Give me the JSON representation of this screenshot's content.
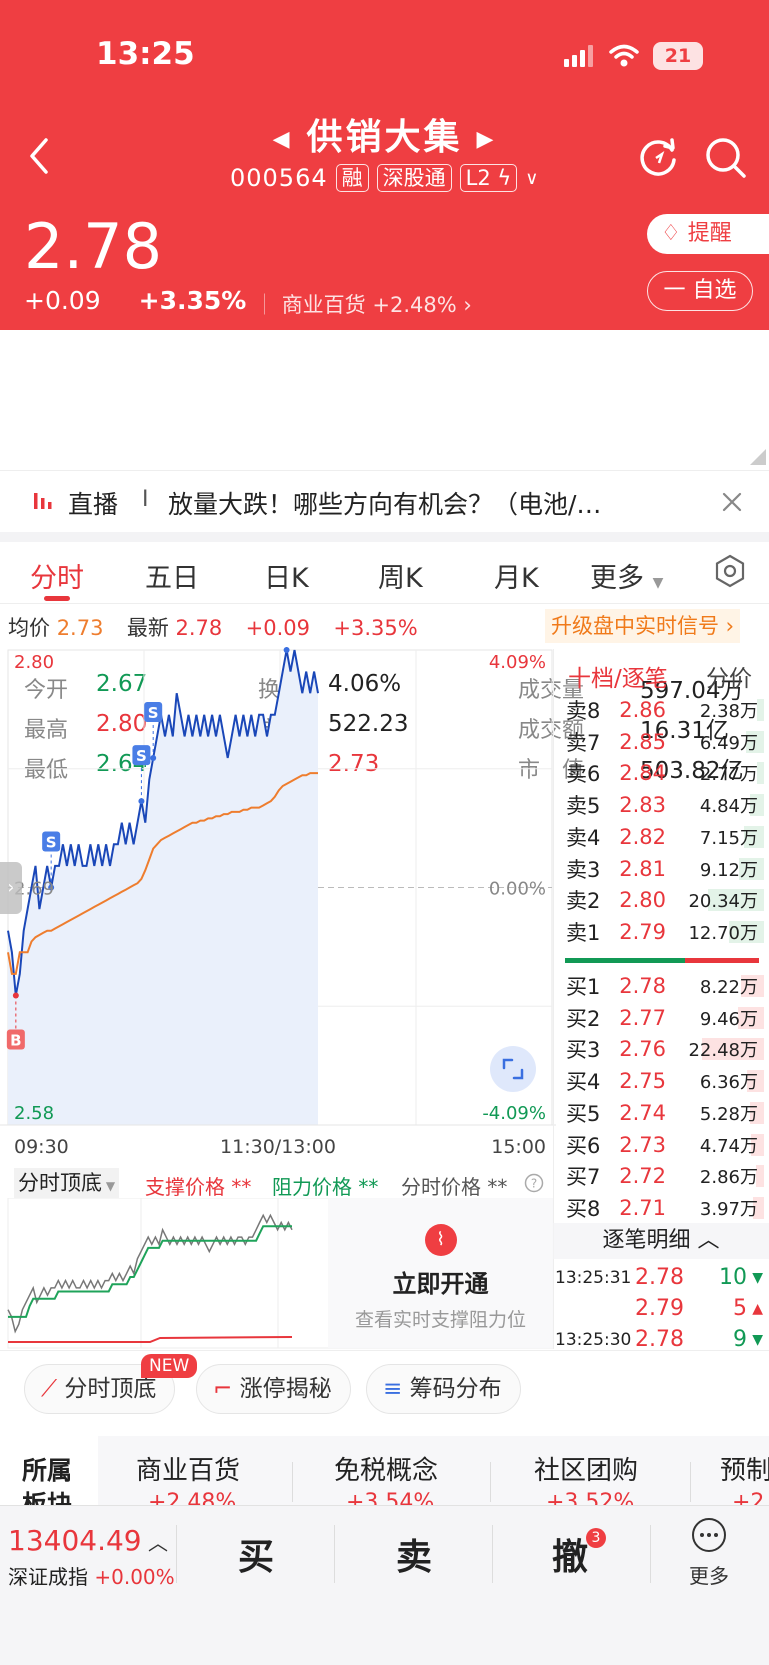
{
  "status": {
    "time": "13:25",
    "battery": "21"
  },
  "header": {
    "name": "供销大集",
    "code": "000564",
    "tag_margin": "融",
    "tag_connect": "深股通",
    "tag_level": "L2",
    "price": "2.78",
    "change": "+0.09",
    "change_pct": "+3.35%",
    "sector_name": "商业百货",
    "sector_pct": "+2.48%",
    "remind_label": "提醒",
    "watch_label": "一 自选"
  },
  "stats": [
    {
      "label": "今开",
      "value": "2.67",
      "tone": "green"
    },
    {
      "label": "换手",
      "value": "4.06%",
      "tone": "dark"
    },
    {
      "label": "成交量",
      "value": "597.04万",
      "tone": "dark"
    },
    {
      "label": "最高",
      "value": "2.80",
      "tone": "red"
    },
    {
      "label": "市盈",
      "value": "522.23",
      "tone": "dark"
    },
    {
      "label": "成交额",
      "value": "16.31亿",
      "tone": "dark"
    },
    {
      "label": "最低",
      "value": "2.64",
      "tone": "green"
    },
    {
      "label": "均价",
      "value": "2.73",
      "tone": "red"
    },
    {
      "label": "市　值",
      "value": "503.82亿",
      "tone": "dark"
    }
  ],
  "live": {
    "tag": "直播",
    "sep": "I",
    "text": "放量大跌！哪些方向有机会？（电池/…"
  },
  "tabs": [
    "分时",
    "五日",
    "日K",
    "周K",
    "月K",
    "更多"
  ],
  "info_bar": {
    "avg_label": "均价",
    "avg_value": "2.73",
    "last_label": "最新",
    "last_value": "2.78",
    "chg": "+0.09",
    "chg_pct": "+3.35%",
    "upgrade": "升级盘中实时信号"
  },
  "chart_data": {
    "type": "line",
    "title": "",
    "y_left_ticks": [
      "2.80",
      "2.69",
      "2.58"
    ],
    "y_right_ticks": [
      "4.09%",
      "0.00%",
      "-4.09%"
    ],
    "x_ticks": [
      "09:30",
      "11:30/13:00",
      "15:00"
    ],
    "ylim": [
      2.58,
      2.8
    ],
    "prev_close": 2.69,
    "series": [
      {
        "name": "price",
        "color": "#1a47b8",
        "values": [
          2.67,
          2.66,
          2.64,
          2.65,
          2.67,
          2.68,
          2.69,
          2.7,
          2.68,
          2.69,
          2.7,
          2.69,
          2.7,
          2.7,
          2.71,
          2.7,
          2.71,
          2.7,
          2.71,
          2.7,
          2.7,
          2.71,
          2.7,
          2.71,
          2.7,
          2.71,
          2.7,
          2.71,
          2.71,
          2.72,
          2.71,
          2.72,
          2.71,
          2.72,
          2.73,
          2.72,
          2.74,
          2.75,
          2.76,
          2.77,
          2.76,
          2.77,
          2.76,
          2.78,
          2.77,
          2.76,
          2.77,
          2.76,
          2.77,
          2.76,
          2.77,
          2.76,
          2.77,
          2.76,
          2.77,
          2.76,
          2.75,
          2.76,
          2.77,
          2.76,
          2.77,
          2.76,
          2.77,
          2.76,
          2.77,
          2.77,
          2.76,
          2.77,
          2.77,
          2.78,
          2.79,
          2.8,
          2.79,
          2.8,
          2.79,
          2.78,
          2.79,
          2.78,
          2.79,
          2.78
        ]
      },
      {
        "name": "avg",
        "color": "#ee7d2e",
        "values": [
          2.66,
          2.65,
          2.65,
          2.66,
          2.66,
          2.66,
          2.665,
          2.667,
          2.668,
          2.669,
          2.67,
          2.67,
          2.671,
          2.672,
          2.673,
          2.674,
          2.675,
          2.676,
          2.677,
          2.678,
          2.679,
          2.68,
          2.681,
          2.682,
          2.683,
          2.684,
          2.685,
          2.686,
          2.687,
          2.688,
          2.689,
          2.69,
          2.691,
          2.692,
          2.694,
          2.698,
          2.703,
          2.708,
          2.71,
          2.712,
          2.713,
          2.714,
          2.715,
          2.716,
          2.717,
          2.718,
          2.719,
          2.72,
          2.72,
          2.721,
          2.721,
          2.722,
          2.722,
          2.723,
          2.723,
          2.724,
          2.724,
          2.725,
          2.725,
          2.725,
          2.726,
          2.726,
          2.727,
          2.727,
          2.727,
          2.728,
          2.729,
          2.73,
          2.732,
          2.735,
          2.737,
          2.738,
          2.739,
          2.74,
          2.741,
          2.742,
          2.742,
          2.743,
          2.743,
          2.743
        ]
      }
    ],
    "markers": [
      {
        "label": "B",
        "type": "buy"
      },
      {
        "label": "S",
        "type": "sell"
      },
      {
        "label": "S",
        "type": "sell"
      },
      {
        "label": "S",
        "type": "sell"
      },
      {
        "label": "S",
        "type": "sell"
      }
    ]
  },
  "order_book": {
    "header_title": "十档/逐笔",
    "header_right": "分价",
    "asks": [
      {
        "label": "卖8",
        "price": "2.86",
        "vol": "2.38万",
        "ratio": 0.11
      },
      {
        "label": "卖7",
        "price": "2.85",
        "vol": "6.49万",
        "ratio": 0.29
      },
      {
        "label": "卖6",
        "price": "2.84",
        "vol": "2.77万",
        "ratio": 0.12
      },
      {
        "label": "卖5",
        "price": "2.83",
        "vol": "4.84万",
        "ratio": 0.22
      },
      {
        "label": "卖4",
        "price": "2.82",
        "vol": "7.15万",
        "ratio": 0.32
      },
      {
        "label": "卖3",
        "price": "2.81",
        "vol": "9.12万",
        "ratio": 0.41
      },
      {
        "label": "卖2",
        "price": "2.80",
        "vol": "20.34万",
        "ratio": 0.9
      },
      {
        "label": "卖1",
        "price": "2.79",
        "vol": "12.70万",
        "ratio": 0.56
      }
    ],
    "bids": [
      {
        "label": "买1",
        "price": "2.78",
        "vol": "8.22万",
        "ratio": 0.37
      },
      {
        "label": "买2",
        "price": "2.77",
        "vol": "9.46万",
        "ratio": 0.42
      },
      {
        "label": "买3",
        "price": "2.76",
        "vol": "22.48万",
        "ratio": 1.0
      },
      {
        "label": "买4",
        "price": "2.75",
        "vol": "6.36万",
        "ratio": 0.28
      },
      {
        "label": "买5",
        "price": "2.74",
        "vol": "5.28万",
        "ratio": 0.23
      },
      {
        "label": "买6",
        "price": "2.73",
        "vol": "4.74万",
        "ratio": 0.21
      },
      {
        "label": "买7",
        "price": "2.72",
        "vol": "2.86万",
        "ratio": 0.13
      },
      {
        "label": "买8",
        "price": "2.71",
        "vol": "3.97万",
        "ratio": 0.18
      }
    ],
    "tick_header": "逐笔明细",
    "ticks": [
      {
        "time": "13:25:31",
        "price": "2.78",
        "vol": "10",
        "dir": "down"
      },
      {
        "time": "",
        "price": "2.79",
        "vol": "5",
        "dir": "up"
      },
      {
        "time": "13:25:30",
        "price": "2.78",
        "vol": "9",
        "dir": "down"
      }
    ]
  },
  "sub_chart": {
    "title": "分时顶底",
    "support": "支撑价格 **",
    "resistance": "阻力价格 **",
    "minute_price": "分时价格 **",
    "cta_title": "立即开通",
    "cta_sub": "查看实时支撑阻力位"
  },
  "pills": [
    {
      "label": "分时顶底",
      "badge": "NEW"
    },
    {
      "label": "涨停揭秘"
    },
    {
      "label": "筹码分布"
    }
  ],
  "sectors": {
    "label": "所属板块",
    "items": [
      {
        "name": "商业百货",
        "pct": "+2.48%"
      },
      {
        "name": "免税概念",
        "pct": "+3.54%"
      },
      {
        "name": "社区团购",
        "pct": "+3.52%"
      },
      {
        "name": "预制",
        "pct": "+2"
      }
    ]
  },
  "bottom": {
    "index_value": "13404.49",
    "index_name": "深证成指",
    "index_pct": "+0.00%",
    "buy": "买",
    "sell": "卖",
    "cancel": "撤",
    "cancel_badge": "3",
    "more": "更多"
  },
  "colors": {
    "brand": "#ef3e42",
    "up": "#e8363c",
    "down": "#119955",
    "price_line": "#1a47b8",
    "avg_line": "#ee7d2e"
  }
}
